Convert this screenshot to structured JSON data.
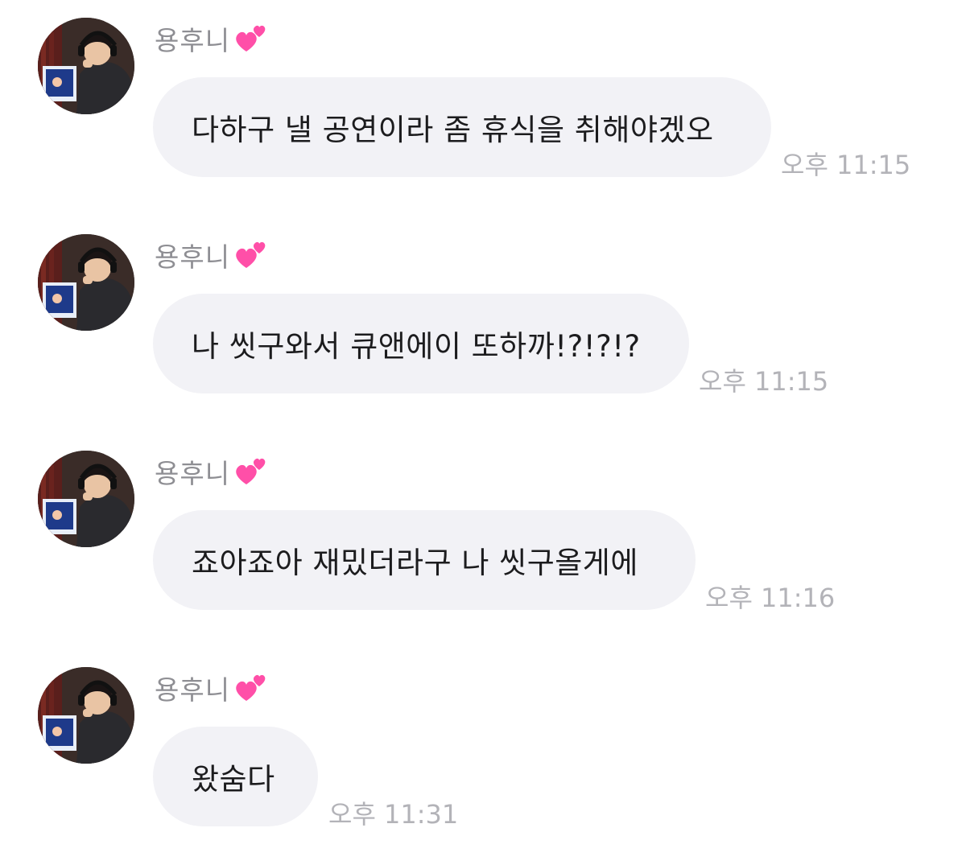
{
  "messages": [
    {
      "sender": "용후니",
      "text": "다하구 낼 공연이라 좀 휴식을 취해야겠오",
      "time": "오후 11:15"
    },
    {
      "sender": "용후니",
      "text": "나 씻구와서 큐앤에이 또하까!?!?!?",
      "time": "오후 11:15"
    },
    {
      "sender": "용후니",
      "text": "죠아죠아 재밌더라구 나 씻구올게에",
      "time": "오후 11:16"
    },
    {
      "sender": "용후니",
      "text": "왔숨다",
      "time": "오후 11:31"
    }
  ],
  "icons": {
    "sender_badge": "two-hearts-icon",
    "avatar": "profile-photo"
  },
  "colors": {
    "bubble_bg": "#f2f2f6",
    "sender_name": "#8e8e93",
    "timestamp": "#b3b3b8",
    "heart": "#ff4fa8",
    "message_text": "#1c1c1e"
  }
}
